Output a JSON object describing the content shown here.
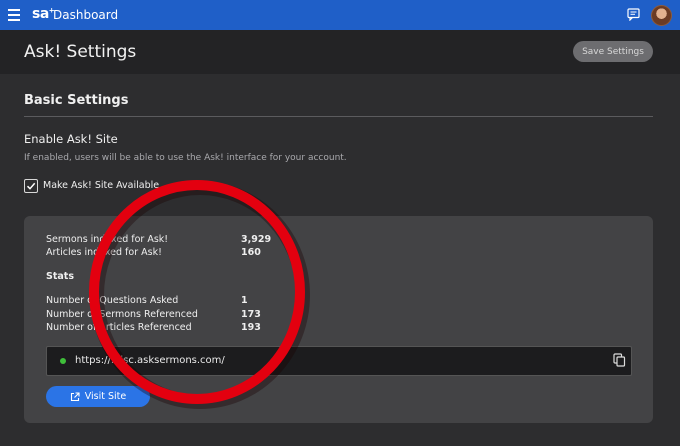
{
  "topbar": {
    "logo": "sa",
    "logo_mark": "+",
    "app_title": "Dashboard",
    "menu_icon": "hamburger-menu-icon",
    "chat_icon": "chat-bubble-icon",
    "accent_color": "#1f5fc8"
  },
  "header": {
    "title": "Ask! Settings",
    "save_label": "Save Settings"
  },
  "basic": {
    "section_title": "Basic Settings",
    "enable_title": "Enable Ask! Site",
    "enable_help": "If enabled, users will be able to use the Ask! interface for your account.",
    "checkbox_label": "Make Ask! Site Available",
    "checkbox_checked": true
  },
  "counts": [
    {
      "label": "Sermons indexed for Ask!",
      "value": "3,929"
    },
    {
      "label": "Articles indexed for Ask!",
      "value": "160"
    }
  ],
  "stats": {
    "heading": "Stats",
    "rows": [
      {
        "label": "Number of Questions Asked",
        "value": "1"
      },
      {
        "label": "Number of Sermons Referenced",
        "value": "173"
      },
      {
        "label": "Number of Articles Referenced",
        "value": "193"
      }
    ]
  },
  "site": {
    "url": "https://...isc.asksermons.com/",
    "status_color": "#3fbf3a",
    "visit_label": "Visit Site",
    "visit_icon": "external-link-icon",
    "copy_icon": "copy-icon"
  },
  "annotation": {
    "type": "red-circle",
    "color": "#e3000f"
  }
}
